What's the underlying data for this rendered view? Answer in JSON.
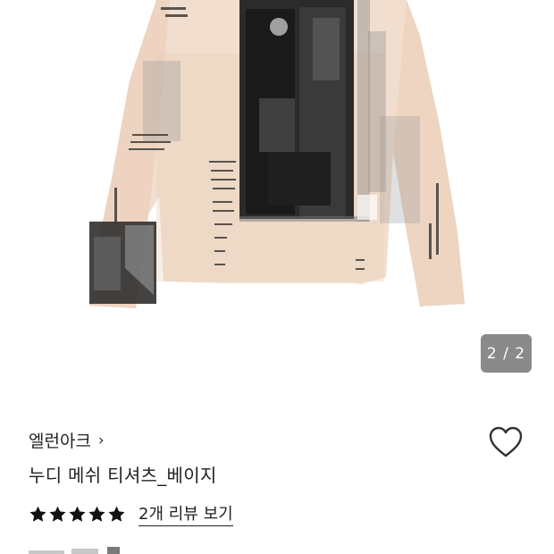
{
  "gallery": {
    "current_page": 2,
    "total_pages": 2,
    "indicator_text": "2 / 2"
  },
  "brand": {
    "name": "엘런아크",
    "chevron": "›"
  },
  "product": {
    "title": "누디 메쉬 티셔츠_베이지"
  },
  "rating": {
    "stars": 5,
    "star_color": "#111111",
    "review_link": "2개 리뷰 보기"
  },
  "icons": {
    "wishlist": "heart-outline-icon",
    "star": "star-icon"
  },
  "colors": {
    "shirt": "#f1dccb",
    "indicator_bg": "#8a8a8a"
  }
}
